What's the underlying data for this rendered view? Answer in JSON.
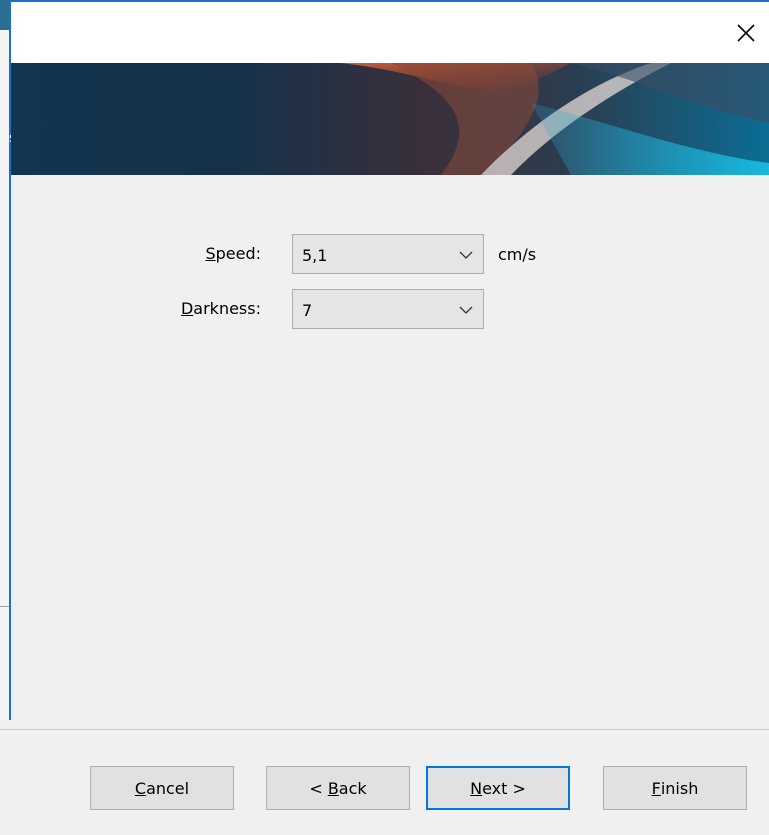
{
  "window": {
    "close_glyph": "×"
  },
  "left_window": {
    "banner_fragment": "s."
  },
  "fields": {
    "speed": {
      "label_access_key": "S",
      "label_rest": "peed:",
      "value": "5,1",
      "unit": "cm/s"
    },
    "darkness": {
      "label_access_key": "D",
      "label_rest": "arkness:",
      "value": "7"
    }
  },
  "buttons": {
    "cancel": {
      "key": "C",
      "rest": "ancel",
      "prefix": ""
    },
    "back": {
      "prefix": "< ",
      "key": "B",
      "rest": "ack"
    },
    "next": {
      "prefix": "",
      "key": "N",
      "rest": "ext >"
    },
    "finish": {
      "prefix": "",
      "key": "F",
      "rest": "inish"
    }
  },
  "colors": {
    "accent_border": "#0078d7",
    "background": "#f0f0f0",
    "button_face": "#e1e1e1"
  }
}
